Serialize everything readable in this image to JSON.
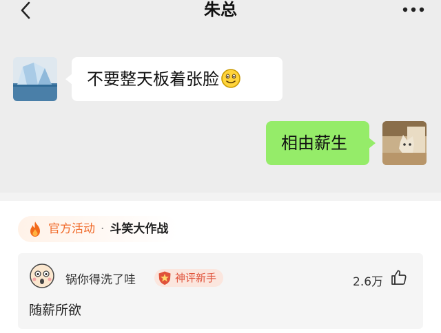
{
  "chat": {
    "title": "朱总",
    "messages": [
      {
        "side": "left",
        "text": "不要整天板着张脸",
        "emoji": "smiling-face-icon"
      },
      {
        "side": "right",
        "text": "相由薪生"
      }
    ]
  },
  "activity": {
    "tag": "官方活动",
    "separator": "·",
    "name": "斗笑大作战"
  },
  "comment": {
    "username": "锅你得洗了哇",
    "badge": "神评新手",
    "like_count": "2.6万",
    "text": "随薪所欲"
  },
  "colors": {
    "chat_bg": "#ededed",
    "sent_bubble": "#95ec69",
    "accent_orange": "#f06a2a",
    "badge_red": "#e0523a"
  }
}
